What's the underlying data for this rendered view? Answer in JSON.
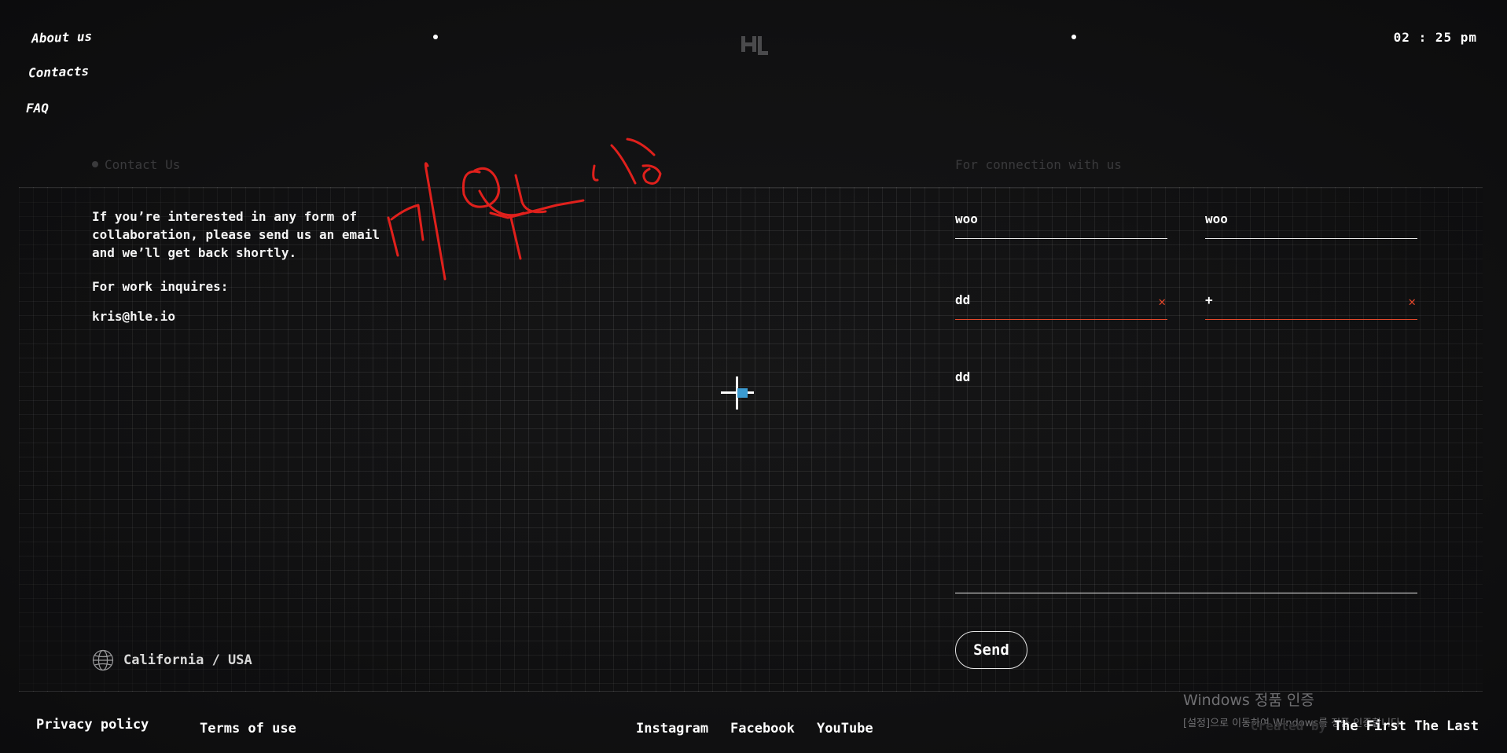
{
  "nav": {
    "items": [
      {
        "label": "About us"
      },
      {
        "label": "Contacts"
      },
      {
        "label": "FAQ"
      }
    ]
  },
  "header": {
    "logo_icon": "hl-logo-icon",
    "clock": "02 : 25 pm"
  },
  "contact": {
    "section_label": "Contact Us",
    "intro": "If you’re interested in any form of collaboration, please send us an email and we’ll get back shortly.",
    "inquiries_label": "For work inquires:",
    "email": "kris@hle.io",
    "location": "California / USA",
    "location_icon": "globe-icon"
  },
  "form": {
    "section_label": "For connection with us",
    "fields": [
      {
        "value": "woo",
        "error": false
      },
      {
        "value": "woo",
        "error": false
      },
      {
        "value": "dd",
        "error": true
      },
      {
        "value": "+",
        "error": true
      }
    ],
    "clear_icon": "close-icon",
    "message": "dd",
    "send_label": "Send",
    "error_color": "#e2482b"
  },
  "footer": {
    "privacy": "Privacy policy",
    "terms": "Terms of use",
    "social": [
      "Instagram",
      "Facebook",
      "YouTube"
    ],
    "credit_prefix": "Created by",
    "credit_studio": "The First The Last"
  },
  "watermark": {
    "title": "Windows 정품 인증",
    "subtitle": "[설정]으로 이동하여 Windows를 정품 인증합니다."
  },
  "annotation": {
    "handwriting_color": "#e0201c",
    "cursor_icon": "crosshair-cursor-icon"
  }
}
